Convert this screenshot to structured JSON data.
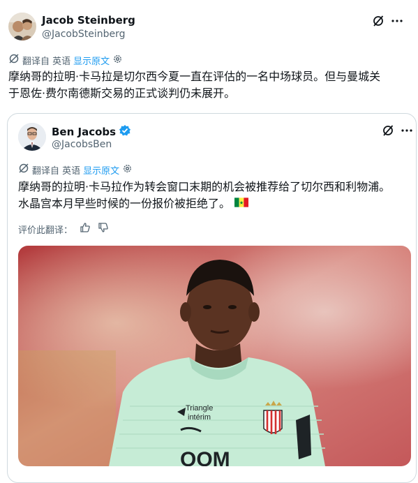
{
  "tweet": {
    "author_name": "Jacob Steinberg",
    "author_handle": "@JacobSteinberg",
    "translate_label": "翻译自 英语",
    "show_original": "显示原文",
    "text_line1": "摩纳哥的拉明·卡马拉是切尔西今夏一直在评估的一名中场球员。但与曼城关",
    "text_line2": "于恩佐·费尔南德斯交易的正式谈判仍未展开。"
  },
  "quoted": {
    "author_name": "Ben Jacobs",
    "author_handle": "@JacobsBen",
    "translate_label": "翻译自 英语",
    "show_original": "显示原文",
    "text_line1": "摩纳哥的拉明·卡马拉作为转会窗口末期的机会被推荐给了切尔西和利物浦。",
    "text_line2": "水晶宫本月早些时候的一份报价被拒绝了。",
    "rate_label": "评价此翻译：",
    "jersey_sponsor": "Triangle intérim",
    "jersey_bottom": "OOM"
  },
  "colors": {
    "verified": "#1d9bf0",
    "link": "#1d9bf0",
    "secondary_text": "#536471",
    "jersey": "#c6ecd6"
  },
  "icons": [
    "grok-icon",
    "more-icon",
    "translate-icon",
    "gear-icon",
    "verified-icon",
    "thumbs-up-icon",
    "thumbs-down-icon",
    "senegal-flag-icon",
    "mizuno-icon",
    "monaco-crest-icon"
  ]
}
